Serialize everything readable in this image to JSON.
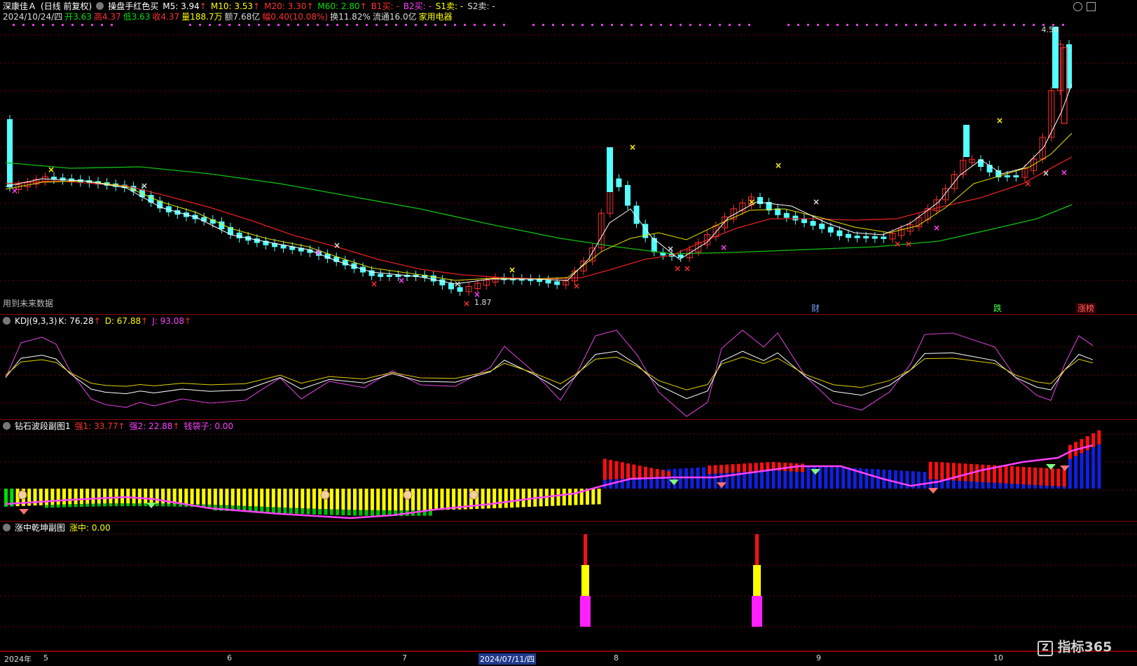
{
  "main": {
    "stock": "深康佳Ａ",
    "mode": "(日线 前复权)",
    "indicator": "操盘手红色买",
    "ma": [
      {
        "label": "M5: 3.94",
        "arrow": "↑",
        "color": "#ffffff"
      },
      {
        "label": "M10: 3.53",
        "arrow": "↑",
        "color": "#ffff00"
      },
      {
        "label": "M20: 3.30",
        "arrow": "↑",
        "color": "#ff3030"
      },
      {
        "label": "M60: 2.80",
        "arrow": "↑",
        "color": "#00e000"
      },
      {
        "label": "B1买: -",
        "arrow": "",
        "color": "#ff3030"
      },
      {
        "label": "B2买: -",
        "arrow": "",
        "color": "#ff40ff"
      },
      {
        "label": "S1卖: -",
        "arrow": "",
        "color": "#ffff00"
      },
      {
        "label": "S2卖: -",
        "arrow": "",
        "color": "#dddddd"
      }
    ],
    "info": [
      {
        "label": "2024/10/24/四",
        "color": "#dddddd"
      },
      {
        "label": "开3.63",
        "color": "#00e000"
      },
      {
        "label": "高4.37",
        "color": "#ff3030"
      },
      {
        "label": "低3.63",
        "color": "#00e000"
      },
      {
        "label": "收4.37",
        "color": "#ff3030"
      },
      {
        "label": "量188.7万",
        "color": "#ffff00"
      },
      {
        "label": "额7.68亿",
        "color": "#dddddd"
      },
      {
        "label": "幅0.40(10.08%)",
        "color": "#ff3030"
      },
      {
        "label": "换11.82%",
        "color": "#dddddd"
      },
      {
        "label": "流通16.0亿",
        "color": "#dddddd"
      },
      {
        "label": "家用电器",
        "color": "#ffff00"
      }
    ],
    "high_label": "4.58",
    "low_label": "1.87",
    "future_note": "用到未来数据",
    "markers": [
      "财",
      "跌",
      "涨榜"
    ]
  },
  "kdj": {
    "title": "KDJ(9,3,3)",
    "k": "K: 76.28",
    "d": "D: 67.88",
    "j": "J: 93.08",
    "arrow": "↑"
  },
  "diamond": {
    "title": "钻石波段副图1",
    "s1": "强1: 33.77",
    "s2": "强2: 22.88",
    "bag": "钱袋子: 0.00",
    "arrow": "↑"
  },
  "zhang": {
    "title": "涨中乾坤副图",
    "value": "涨中: 0.00"
  },
  "xaxis": {
    "year": "2024年",
    "months": [
      "5",
      "6",
      "7",
      "8",
      "9",
      "10"
    ],
    "selected_date": "2024/07/11/四"
  },
  "logo": "指标365",
  "colors": {
    "up": "#ff3030",
    "down": "#54ffff",
    "ma5": "#ffffff",
    "ma10": "#e8e000",
    "ma20": "#e02020",
    "ma60": "#10c010"
  }
}
